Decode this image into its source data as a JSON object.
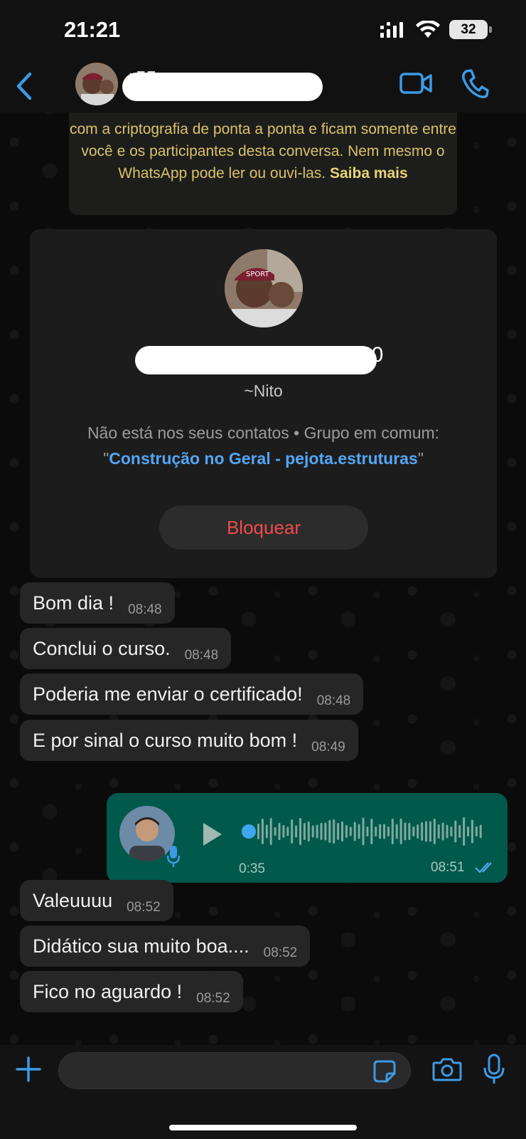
{
  "status_bar": {
    "time": "21:21",
    "battery": "32"
  },
  "header": {
    "contact_name_partial": "+55"
  },
  "encryption_notice": {
    "text": "com a criptografia de ponta a ponta e ficam somente entre você e os participantes desta conversa. Nem mesmo o WhatsApp pode ler ou ouvi-las.",
    "link": "Saiba mais"
  },
  "contact_card": {
    "name_partial": "40",
    "nickname": "~Nito",
    "info_prefix": "Não está nos seus contatos • Grupo em comum:",
    "group_name": "Construção no Geral - pejota.estruturas",
    "block_label": "Bloquear"
  },
  "messages": [
    {
      "text": "Bom dia !",
      "time": "08:48"
    },
    {
      "text": "Conclui o curso.",
      "time": "08:48"
    },
    {
      "text": "Poderia me enviar o certificado!",
      "time": "08:48"
    },
    {
      "text": "E por sinal o curso muito bom !",
      "time": "08:49"
    },
    {
      "text": "Valeuuuu",
      "time": "08:52"
    },
    {
      "text": "Didático sua muito boa....",
      "time": "08:52"
    },
    {
      "text": "Fico no aguardo !",
      "time": "08:52"
    }
  ],
  "voice_message": {
    "duration": "0:35",
    "time": "08:51",
    "progress": 0
  },
  "input": {
    "value": ""
  },
  "colors": {
    "accent_blue": "#3b9be6",
    "outgoing_bubble": "#00594b",
    "incoming_bubble": "#262626",
    "block_red": "#ee4b4b",
    "notice_yellow": "#d9c36a"
  },
  "icons": [
    "back-chevron-icon",
    "video-call-icon",
    "phone-call-icon",
    "play-icon",
    "microphone-icon",
    "double-check-icon",
    "plus-icon",
    "sticker-icon",
    "camera-icon",
    "mic-icon"
  ]
}
